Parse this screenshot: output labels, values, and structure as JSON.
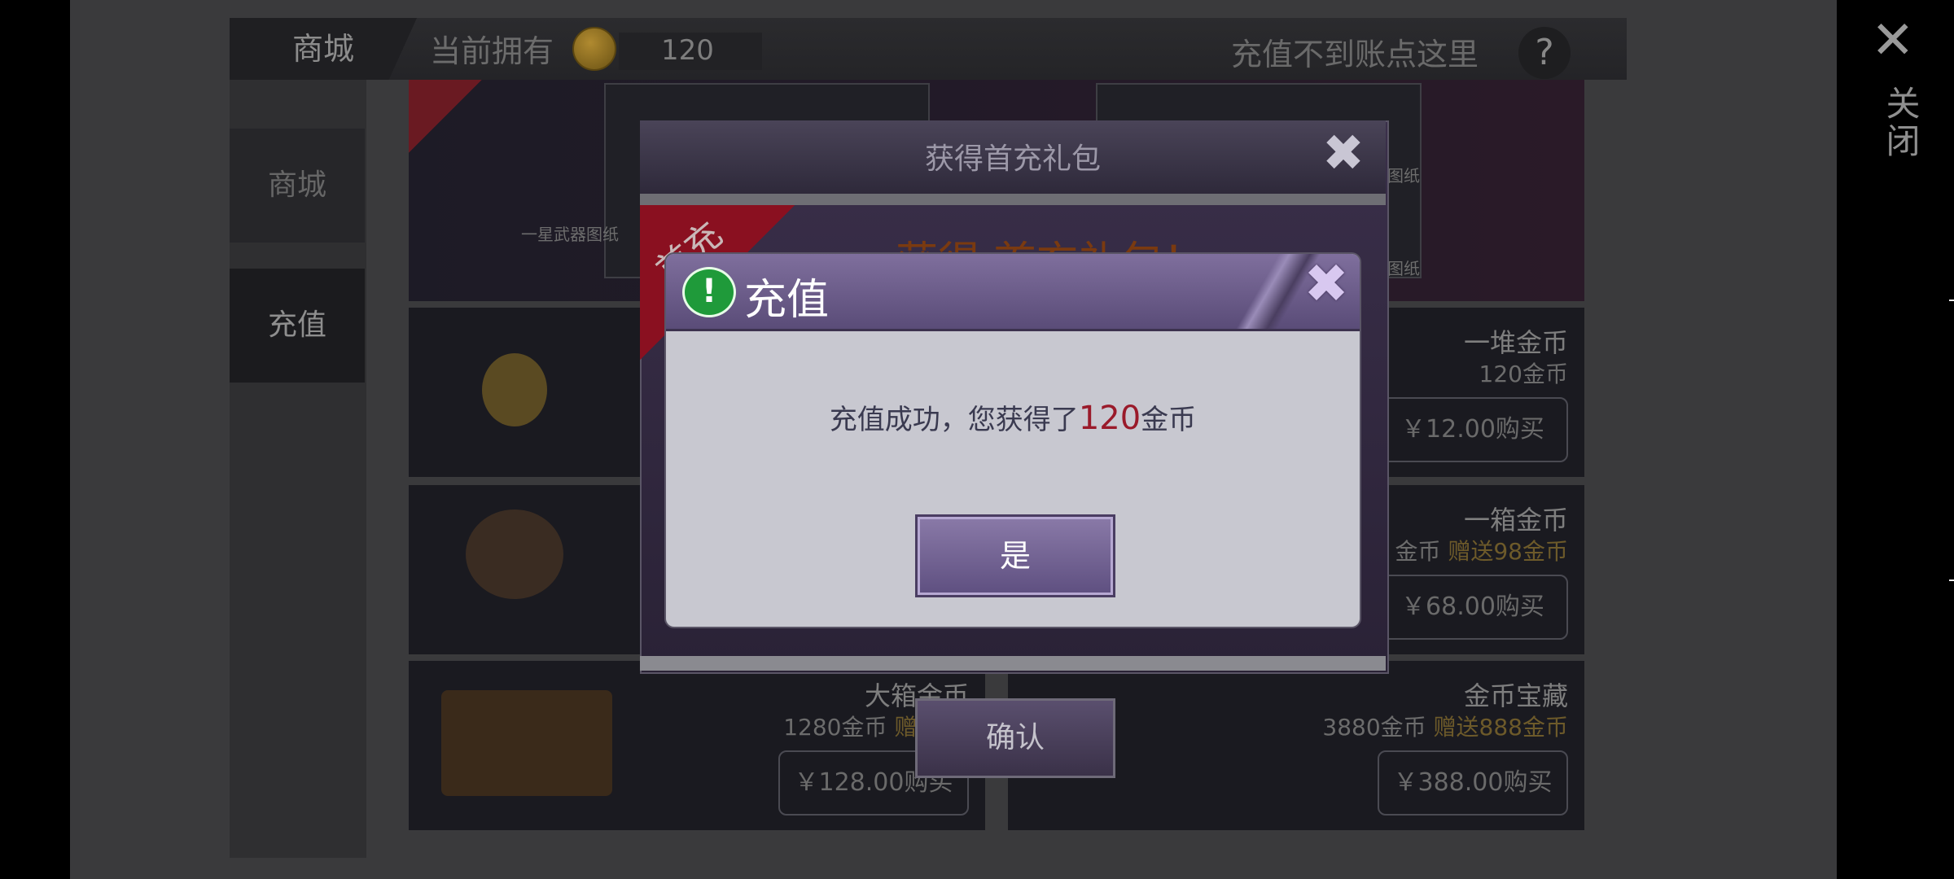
{
  "right_bar": {
    "close_symbol": "✕",
    "close_label": "关闭"
  },
  "shop": {
    "header_tab": "商城",
    "owned_label": "当前拥有",
    "owned_value": "120",
    "help_text": "充值不到账点这里",
    "help_symbol": "?",
    "sidebar": [
      {
        "label": "商城"
      },
      {
        "label": "充值"
      }
    ],
    "banner": {
      "item_left_label": "一星武器图纸",
      "item_right_label_1": "图纸",
      "item_right_label_2": "图纸"
    },
    "tiles": [
      {
        "name": "一堆金币",
        "amount": "120金币",
        "bonus": "",
        "price": "￥12.00购买"
      },
      {
        "name": "一箱金币",
        "amount": "金币",
        "bonus": "赠送98金币",
        "price": "￥68.00购买"
      },
      {
        "name": "大箱金币",
        "amount": "1280金币",
        "bonus": "赠送28",
        "price": "￥128.00购买"
      },
      {
        "name": "金币宝藏",
        "amount": "3880金币",
        "bonus": "赠送888金币",
        "price": "￥388.00购买"
      }
    ]
  },
  "back_dialog": {
    "title": "获得首充礼包",
    "banner_text": "获得  首充礼包！",
    "ribbon_text": "首充",
    "confirm_label": "确认"
  },
  "dialog": {
    "title": "充值",
    "message_prefix": "充值成功，您获得了",
    "message_amount": "120",
    "message_suffix": "金币",
    "yes_label": "是"
  },
  "colors": {
    "dialog_header": "#6a5a8a",
    "dialog_body": "#c8c8d0",
    "amount_highlight": "#9a1a2a",
    "alert_icon": "#1f9a3a"
  }
}
